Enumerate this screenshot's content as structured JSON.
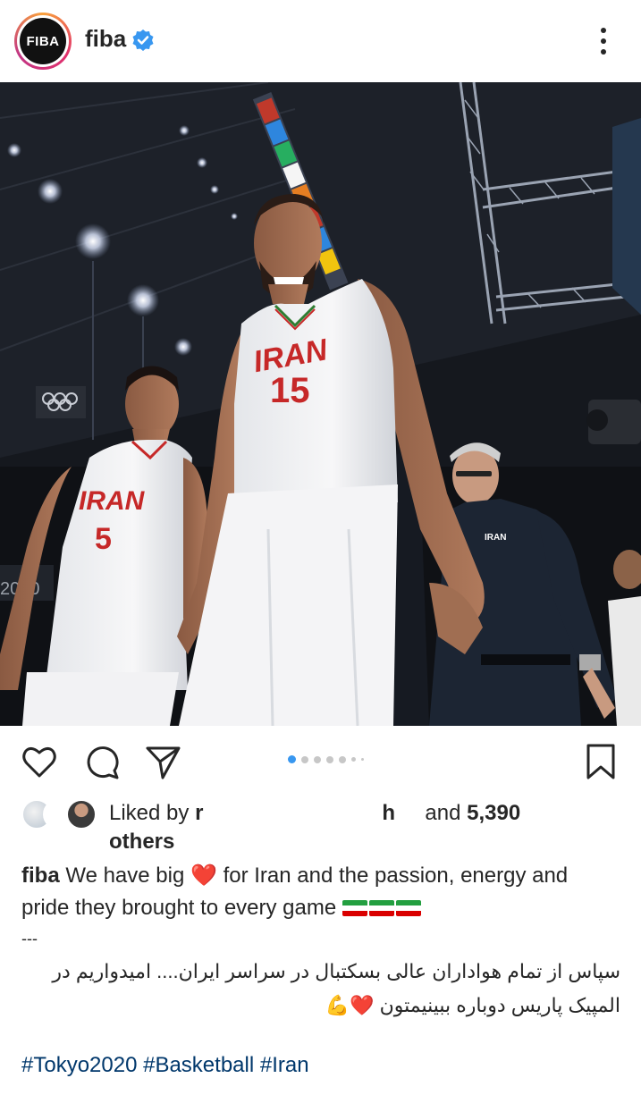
{
  "header": {
    "avatar_text": "FIBA",
    "username": "fiba"
  },
  "post": {
    "jersey_main_text": "IRAN",
    "jersey_main_number": "15",
    "jersey_left_text": "IRAN",
    "jersey_left_number": "5",
    "coach_shirt_text": "IRAN",
    "arena_sign": "2020"
  },
  "carousel": {
    "count": 7,
    "active_index": 0
  },
  "likes": {
    "prefix": "Liked by",
    "user_a": "r",
    "user_b": "h",
    "middle": "and",
    "count": "5,390",
    "suffix": "others"
  },
  "caption": {
    "username": "fiba",
    "part1": "We have big",
    "heart": "❤️",
    "part2": "for Iran and the passion, energy and pride they brought to every game",
    "separator": "---",
    "persian": "سپاس از تمام هواداران عالی بسکتبال در سراسر ایران.... امیدواریم در المپیک پاریس دوباره ببینیمتون",
    "persian_emojis": "❤️💪",
    "hashtags": "#Tokyo2020 #Basketball #Iran"
  },
  "colors": {
    "verified": "#3897f0",
    "link": "#00376b",
    "active_dot": "#3897f0"
  }
}
